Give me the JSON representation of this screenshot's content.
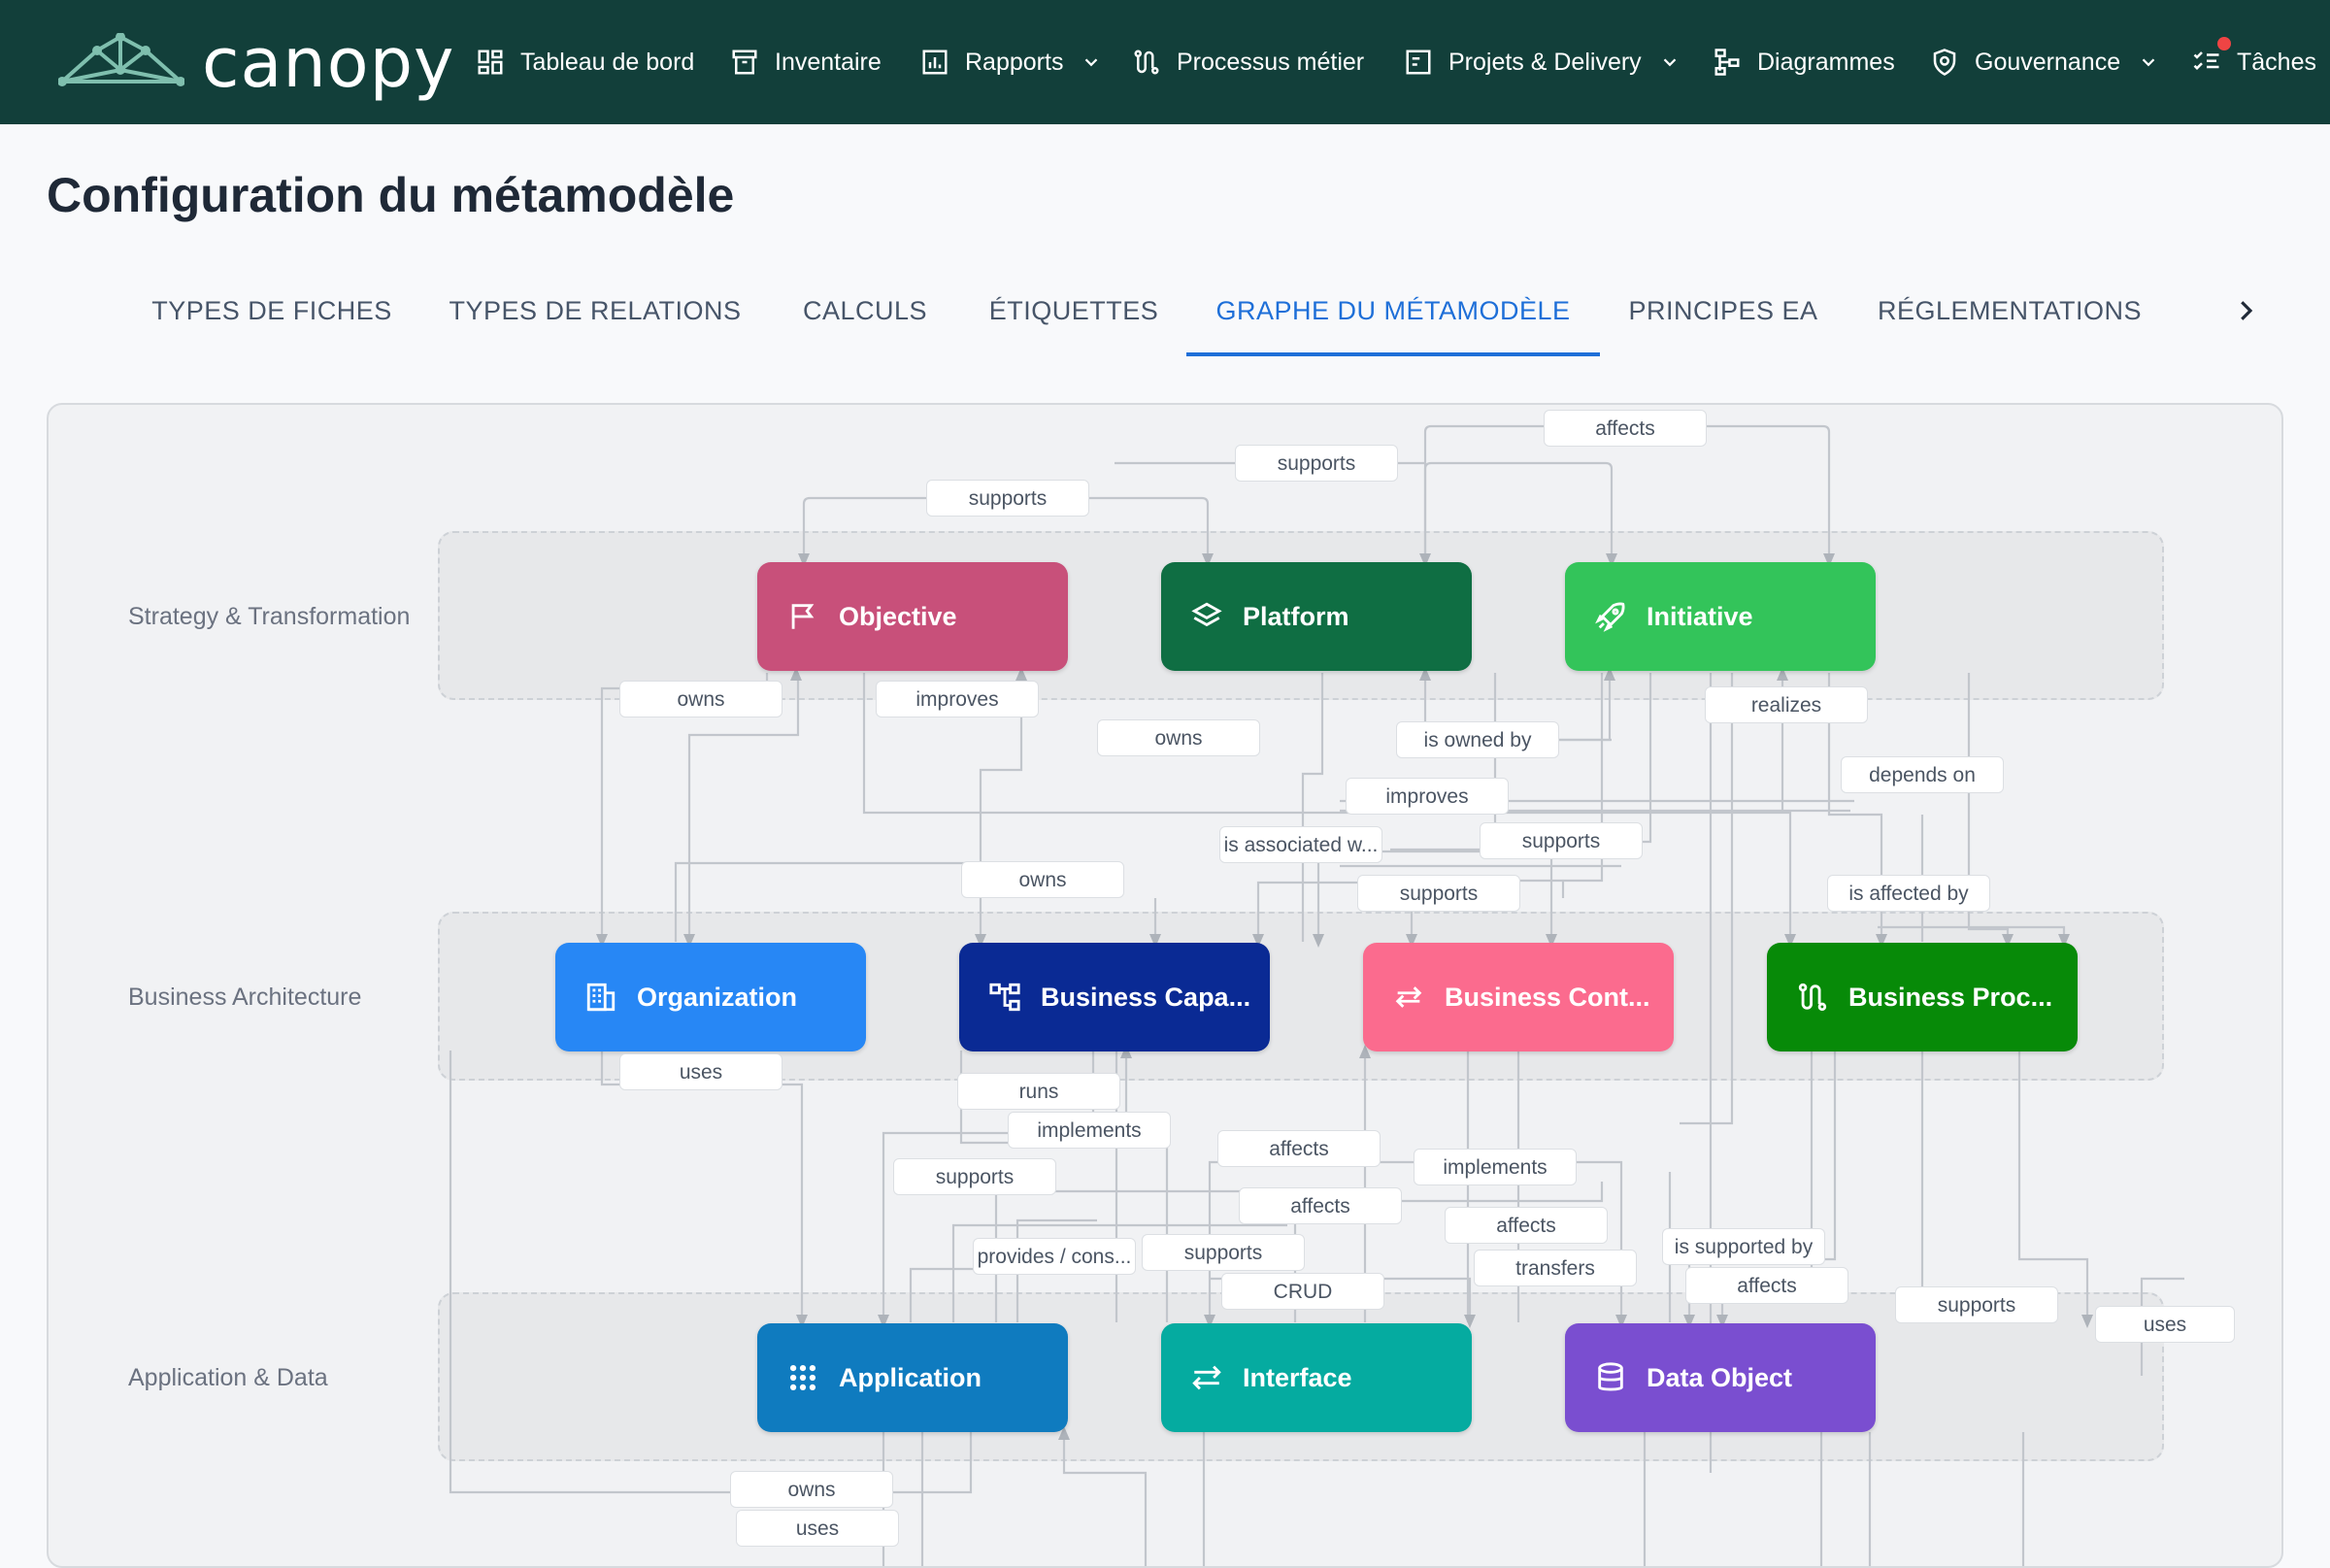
{
  "app": {
    "logo_text": "canopy"
  },
  "nav": {
    "dashboard": "Tableau de bord",
    "inventory": "Inventaire",
    "reports": "Rapports",
    "processes": "Processus métier",
    "projects": "Projets & Delivery",
    "diagrams": "Diagrammes",
    "governance": "Gouvernance",
    "tasks": "Tâches"
  },
  "page": {
    "title": "Configuration du métamodèle"
  },
  "tabs": [
    {
      "label": "TYPES DE FICHES"
    },
    {
      "label": "TYPES DE RELATIONS"
    },
    {
      "label": "CALCULS"
    },
    {
      "label": "ÉTIQUETTES"
    },
    {
      "label": "GRAPHE DU MÉTAMODÈLE",
      "active": true
    },
    {
      "label": "PRINCIPES EA"
    },
    {
      "label": "RÉGLEMENTATIONS"
    }
  ],
  "layers": [
    {
      "name": "Strategy & Transformation"
    },
    {
      "name": "Business Architecture"
    },
    {
      "name": "Application & Data"
    }
  ],
  "nodes": {
    "objective": {
      "label": "Objective",
      "color": "#c8507a",
      "icon": "flag-icon"
    },
    "platform": {
      "label": "Platform",
      "color": "#0f6e43",
      "icon": "layers-icon"
    },
    "initiative": {
      "label": "Initiative",
      "color": "#33c45a",
      "icon": "rocket-icon"
    },
    "organization": {
      "label": "Organization",
      "color": "#2787f5",
      "icon": "building-icon"
    },
    "business_capability": {
      "label": "Business Capa...",
      "color": "#0a2a94",
      "icon": "hierarchy-icon"
    },
    "business_context": {
      "label": "Business Cont...",
      "color": "#fb6b8e",
      "icon": "arrows-icon"
    },
    "business_process": {
      "label": "Business Proc...",
      "color": "#078a08",
      "icon": "process-icon"
    },
    "application": {
      "label": "Application",
      "color": "#0f7bbf",
      "icon": "grid-icon"
    },
    "interface": {
      "label": "Interface",
      "color": "#05aba0",
      "icon": "swap-icon"
    },
    "data_object": {
      "label": "Data Object",
      "color": "#7a4ed0",
      "icon": "database-icon"
    }
  },
  "edge_labels": {
    "affects_top": "affects",
    "supports_top": "supports",
    "supports_obj": "supports",
    "owns_org": "owns",
    "improves_obj": "improves",
    "owns_plat": "owns",
    "is_owned_by": "is owned by",
    "realizes": "realizes",
    "depends_on": "depends on",
    "improves_mid": "improves",
    "is_associated": "is associated w...",
    "supports_mid": "supports",
    "owns_cap": "owns",
    "supports_ctx": "supports",
    "is_affected_by": "is affected by",
    "uses_org": "uses",
    "runs": "runs",
    "implements_1": "implements",
    "affects_1": "affects",
    "implements_2": "implements",
    "supports_app": "supports",
    "affects_2": "affects",
    "affects_3": "affects",
    "is_supported_by": "is supported by",
    "provides": "provides / cons...",
    "supports_if": "supports",
    "transfers": "transfers",
    "affects_4": "affects",
    "crud": "CRUD",
    "supports_do": "supports",
    "uses_right": "uses",
    "owns_app": "owns",
    "uses_app": "uses"
  }
}
